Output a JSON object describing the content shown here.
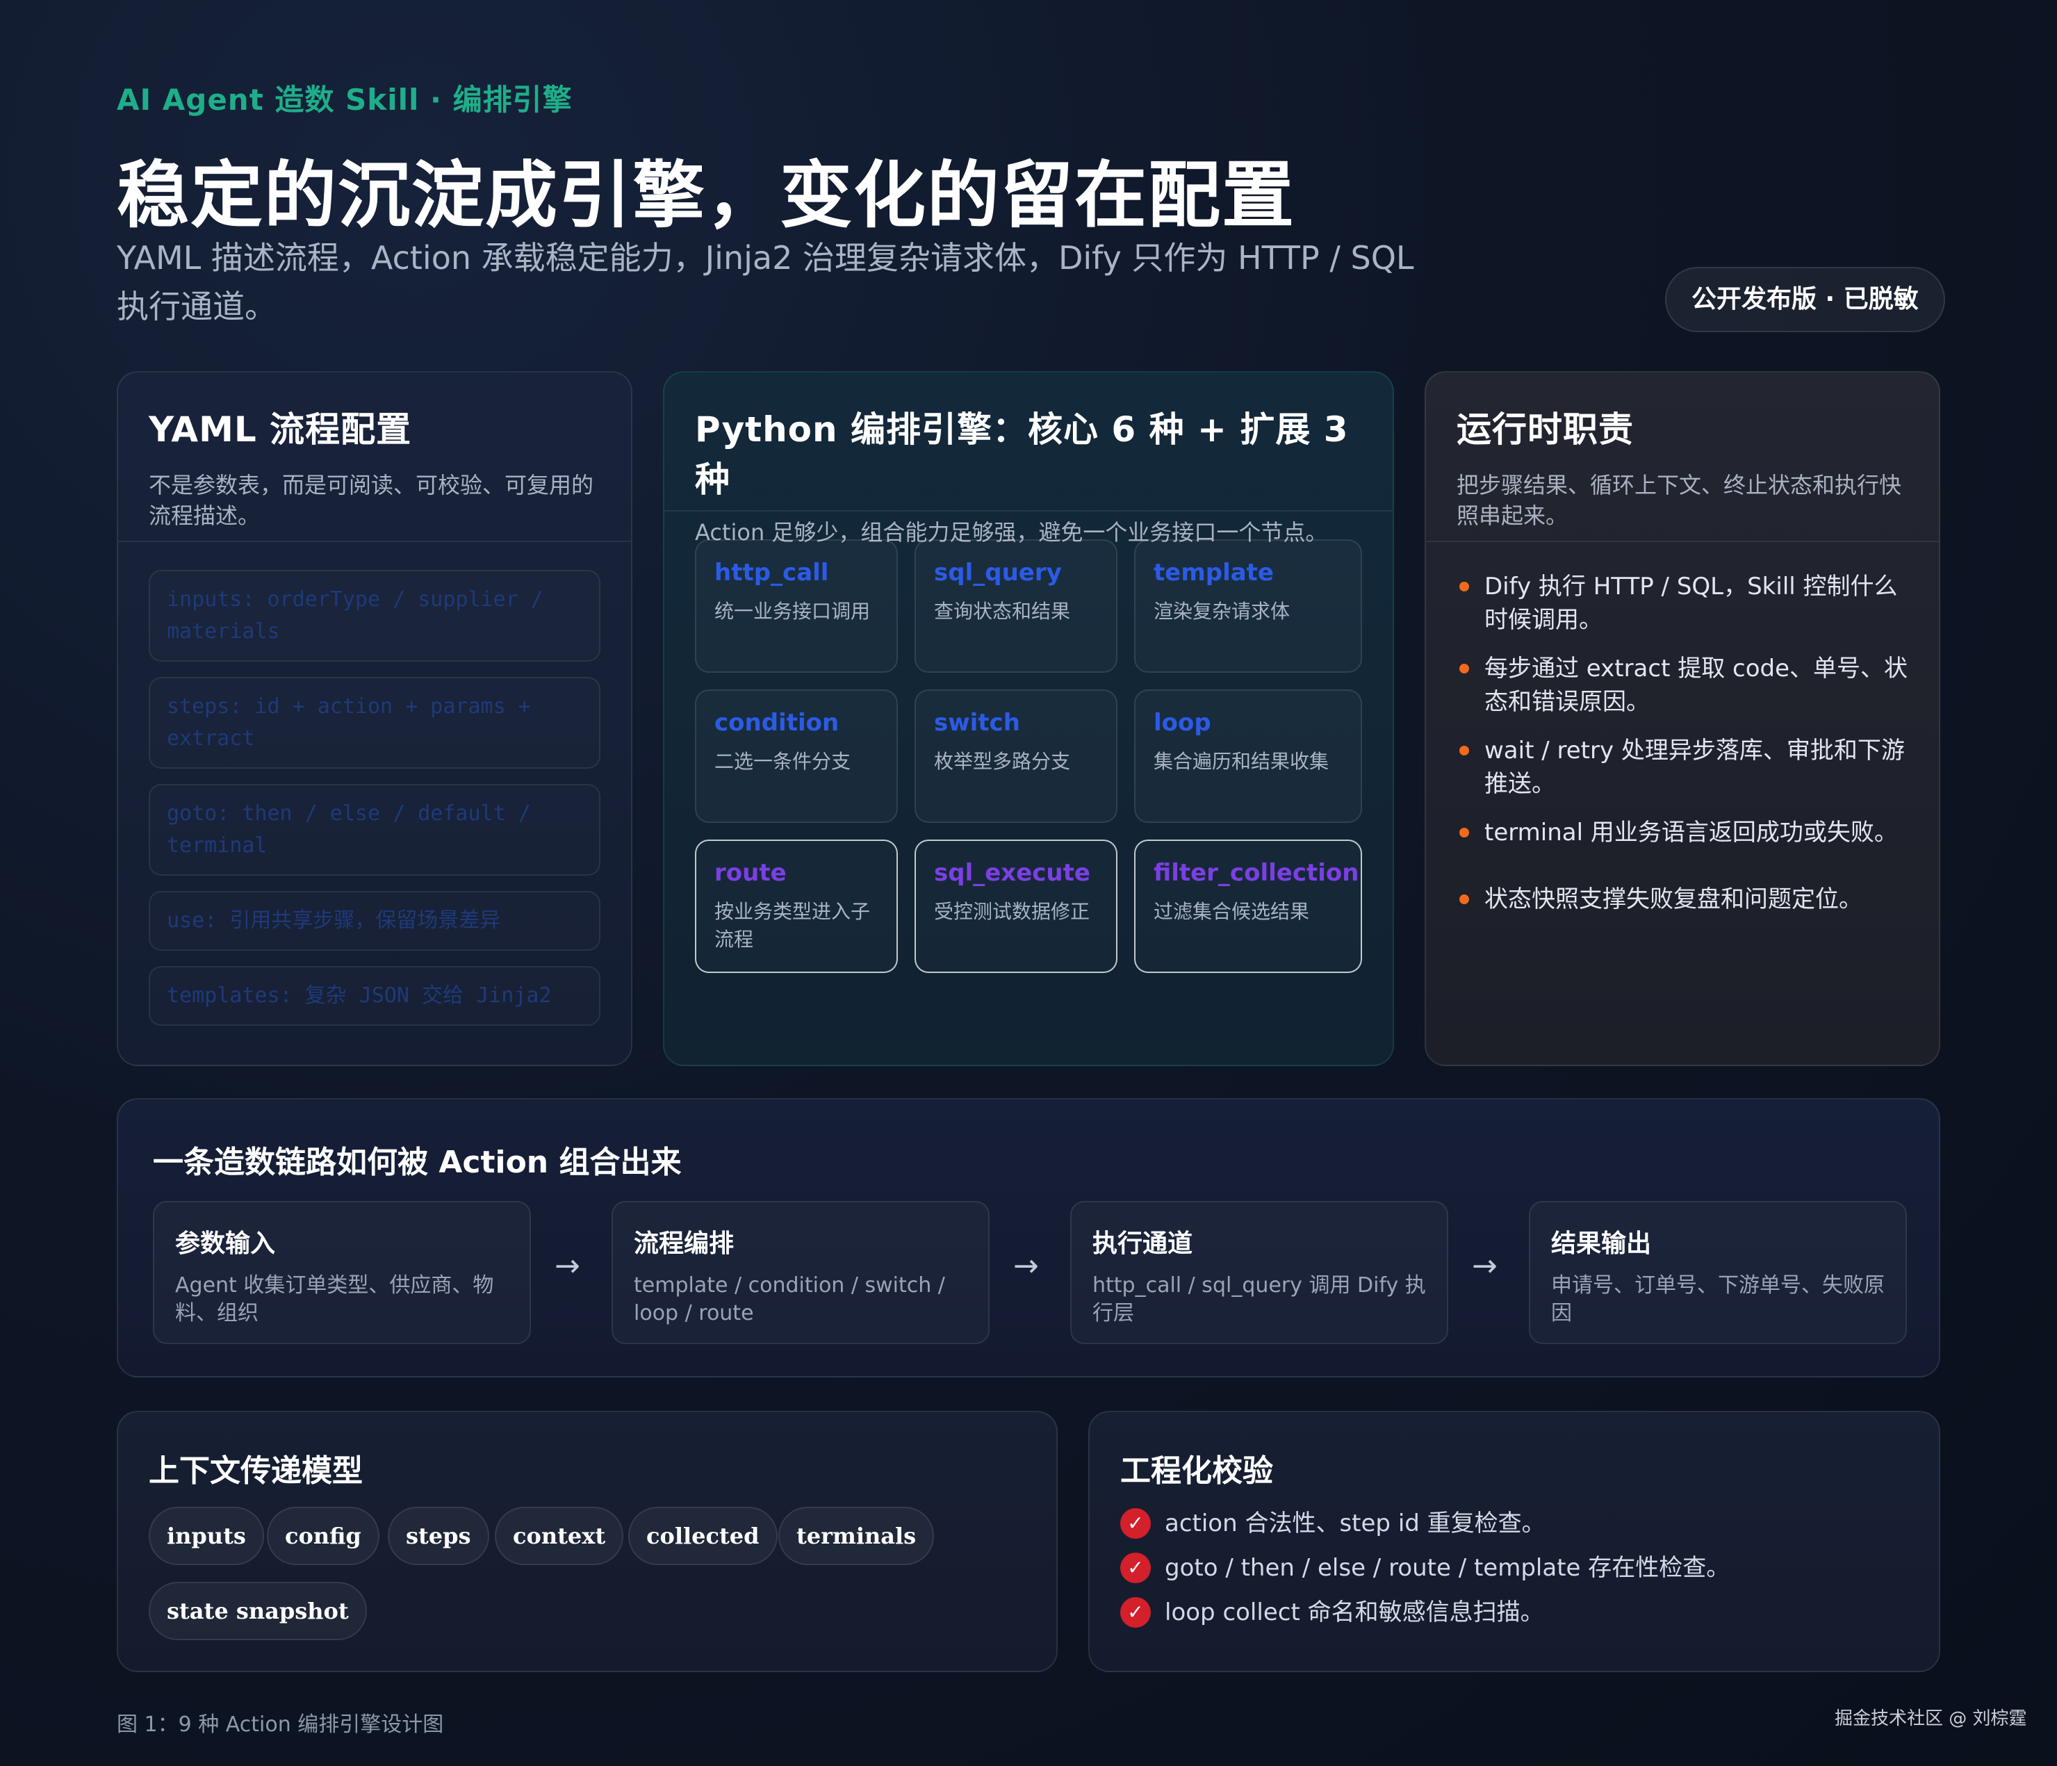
{
  "header": {
    "eyebrow": "AI Agent 造数 Skill · 编排引擎",
    "title": "稳定的沉淀成引擎，变化的留在配置",
    "subtitle": "YAML 描述流程，Action 承载稳定能力，Jinja2 治理复杂请求体，Dify 只作为 HTTP / SQL 执行通道。",
    "badge": "公开发布版 · 已脱敏"
  },
  "yaml_panel": {
    "title": "YAML 流程配置",
    "desc": "不是参数表，而是可阅读、可校验、可复用的流程描述。",
    "items": [
      "inputs: orderType / supplier / materials",
      "steps: id + action + params + extract",
      "goto: then / else / default / terminal",
      "use: 引用共享步骤，保留场景差异",
      "templates: 复杂 JSON 交给 Jinja2"
    ]
  },
  "python_panel": {
    "title": "Python 编排引擎：核心 6 种 + 扩展 3 种",
    "desc": "Action 足够少，组合能力足够强，避免一个业务接口一个节点。",
    "actions": [
      {
        "name": "http_call",
        "desc": "统一业务接口调用",
        "ext": false
      },
      {
        "name": "sql_query",
        "desc": "查询状态和结果",
        "ext": false
      },
      {
        "name": "template",
        "desc": "渲染复杂请求体",
        "ext": false
      },
      {
        "name": "condition",
        "desc": "二选一条件分支",
        "ext": false
      },
      {
        "name": "switch",
        "desc": "枚举型多路分支",
        "ext": false
      },
      {
        "name": "loop",
        "desc": "集合遍历和结果收集",
        "ext": false
      },
      {
        "name": "route",
        "desc": "按业务类型进入子流程",
        "ext": true
      },
      {
        "name": "sql_execute",
        "desc": "受控测试数据修正",
        "ext": true
      },
      {
        "name": "filter_collection",
        "desc": "过滤集合候选结果",
        "ext": true
      }
    ],
    "colors": {
      "core": "#2b5be6",
      "extended": "#7b3fe4"
    }
  },
  "runtime_panel": {
    "title": "运行时职责",
    "desc": "把步骤结果、循环上下文、终止状态和执行快照串起来。",
    "items": [
      "Dify 执行 HTTP / SQL，Skill 控制什么时候调用。",
      "每步通过 extract 提取 code、单号、状态和错误原因。",
      "wait / retry 处理异步落库、审批和下游推送。",
      "terminal 用业务语言返回成功或失败。",
      "状态快照支撑失败复盘和问题定位。"
    ],
    "bullet_color": "#f26a1b"
  },
  "chain_panel": {
    "title": "一条造数链路如何被 Action 组合出来",
    "arrow": "→",
    "steps": [
      {
        "title": "参数输入",
        "desc": "Agent 收集订单类型、供应商、物料、组织"
      },
      {
        "title": "流程编排",
        "desc": "template / condition / switch / loop / route"
      },
      {
        "title": "执行通道",
        "desc": "http_call / sql_query 调用 Dify 执行层"
      },
      {
        "title": "结果输出",
        "desc": "申请号、订单号、下游单号、失败原因"
      }
    ]
  },
  "context_panel": {
    "title": "上下文传递模型",
    "chips": [
      "inputs",
      "config",
      "steps",
      "context",
      "collected",
      "terminals",
      "state snapshot"
    ]
  },
  "engineering_panel": {
    "title": "工程化校验",
    "check_mark": "✓",
    "items": [
      "action 合法性、step id 重复检查。",
      "goto / then / else / route / template 存在性检查。",
      "loop collect 命名和敏感信息扫描。"
    ],
    "check_color": "#d3202a"
  },
  "footer": {
    "caption": "图 1：9 种 Action 编排引擎设计图",
    "watermark": "掘金技术社区 @ 刘棕霆"
  },
  "colors": {
    "accent": "#1fae8a",
    "background": "#0e1626"
  }
}
